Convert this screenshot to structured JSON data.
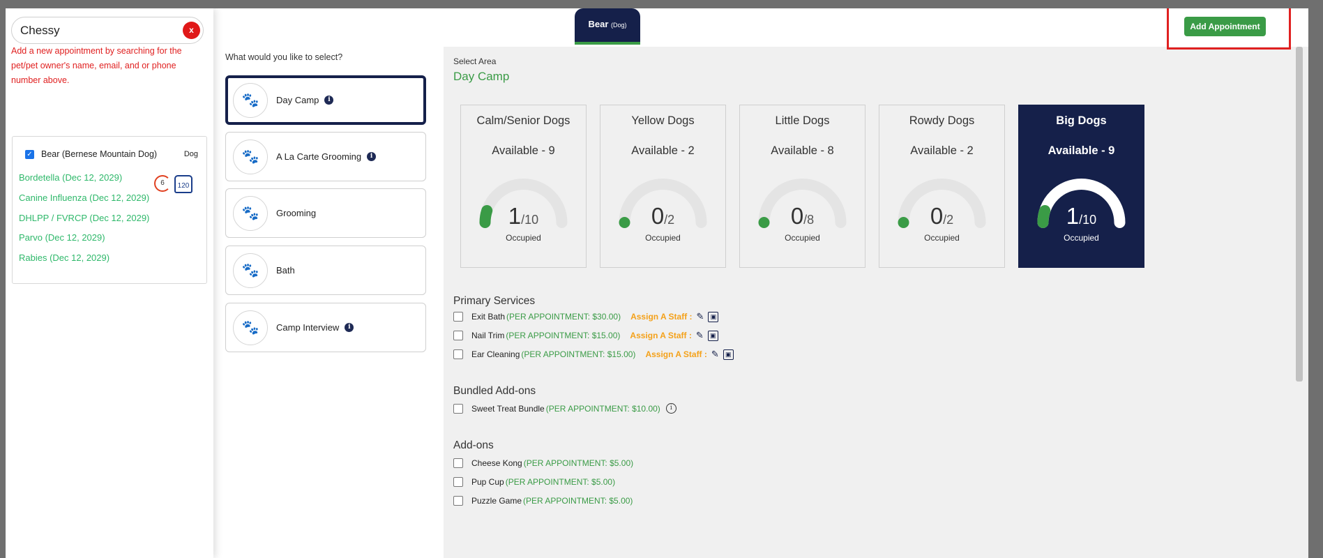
{
  "search": {
    "value": "Chessy",
    "clear_label": "x"
  },
  "hint_text": "Add a new appointment by searching for the pet/pet owner's name, email, and or phone number above.",
  "pet": {
    "name": "Bear (Bernese Mountain Dog)",
    "type": "Dog",
    "badge_count": "6",
    "weight": "120",
    "vaccines": [
      "Bordetella (Dec 12, 2029)",
      "Canine Influenza (Dec 12, 2029)",
      "DHLPP / FVRCP (Dec 12, 2029)",
      "Parvo (Dec 12, 2029)",
      "Rabies (Dec 12, 2029)"
    ]
  },
  "select_question": "What would you like to select?",
  "services": [
    {
      "label": "Day Camp",
      "info": true,
      "active": true
    },
    {
      "label": "A La Carte Grooming",
      "info": true,
      "active": false
    },
    {
      "label": "Grooming",
      "info": false,
      "active": false
    },
    {
      "label": "Bath",
      "info": false,
      "active": false
    },
    {
      "label": "Camp Interview",
      "info": true,
      "active": false
    }
  ],
  "header": {
    "pet_tab": "Bear",
    "pet_tab_type": "(Dog)",
    "add_button": "Add Appointment",
    "close": "×"
  },
  "select_area_label": "Select Area",
  "area_group": "Day Camp",
  "areas": [
    {
      "name": "Calm/Senior Dogs",
      "available": "Available - 9",
      "occupied": 1,
      "capacity": 10,
      "cap_text": "/10",
      "label": "Occupied",
      "active": false
    },
    {
      "name": "Yellow Dogs",
      "available": "Available - 2",
      "occupied": 0,
      "capacity": 2,
      "cap_text": "/2",
      "label": "Occupied",
      "active": false
    },
    {
      "name": "Little Dogs",
      "available": "Available - 8",
      "occupied": 0,
      "capacity": 8,
      "cap_text": "/8",
      "label": "Occupied",
      "active": false
    },
    {
      "name": "Rowdy Dogs",
      "available": "Available - 2",
      "occupied": 0,
      "capacity": 2,
      "cap_text": "/2",
      "label": "Occupied",
      "active": false
    },
    {
      "name": "Big Dogs",
      "available": "Available - 9",
      "occupied": 1,
      "capacity": 10,
      "cap_text": "/10",
      "label": "Occupied",
      "active": true
    }
  ],
  "primary_services": {
    "title": "Primary Services",
    "assign_label": "Assign A Staff :",
    "items": [
      {
        "name": "Exit Bath",
        "price": "(PER APPOINTMENT: $30.00)"
      },
      {
        "name": "Nail Trim",
        "price": "(PER APPOINTMENT: $15.00)"
      },
      {
        "name": "Ear Cleaning",
        "price": "(PER APPOINTMENT: $15.00)"
      }
    ]
  },
  "bundled_addons": {
    "title": "Bundled Add-ons",
    "items": [
      {
        "name": "Sweet Treat Bundle",
        "price": "(PER APPOINTMENT: $10.00)"
      }
    ]
  },
  "addons": {
    "title": "Add-ons",
    "items": [
      {
        "name": "Cheese Kong",
        "price": "(PER APPOINTMENT: $5.00)"
      },
      {
        "name": "Pup Cup",
        "price": "(PER APPOINTMENT: $5.00)"
      },
      {
        "name": "Puzzle Game",
        "price": "(PER APPOINTMENT: $5.00)"
      }
    ]
  },
  "colors": {
    "navy": "#15204a",
    "green": "#3a9b46",
    "red": "#e02020",
    "orange": "#f4a11a"
  },
  "icons": {
    "service": "paw-icon",
    "info": "info-icon",
    "assign_staff": "person-edit-icon",
    "assign_image": "image-edit-icon"
  }
}
